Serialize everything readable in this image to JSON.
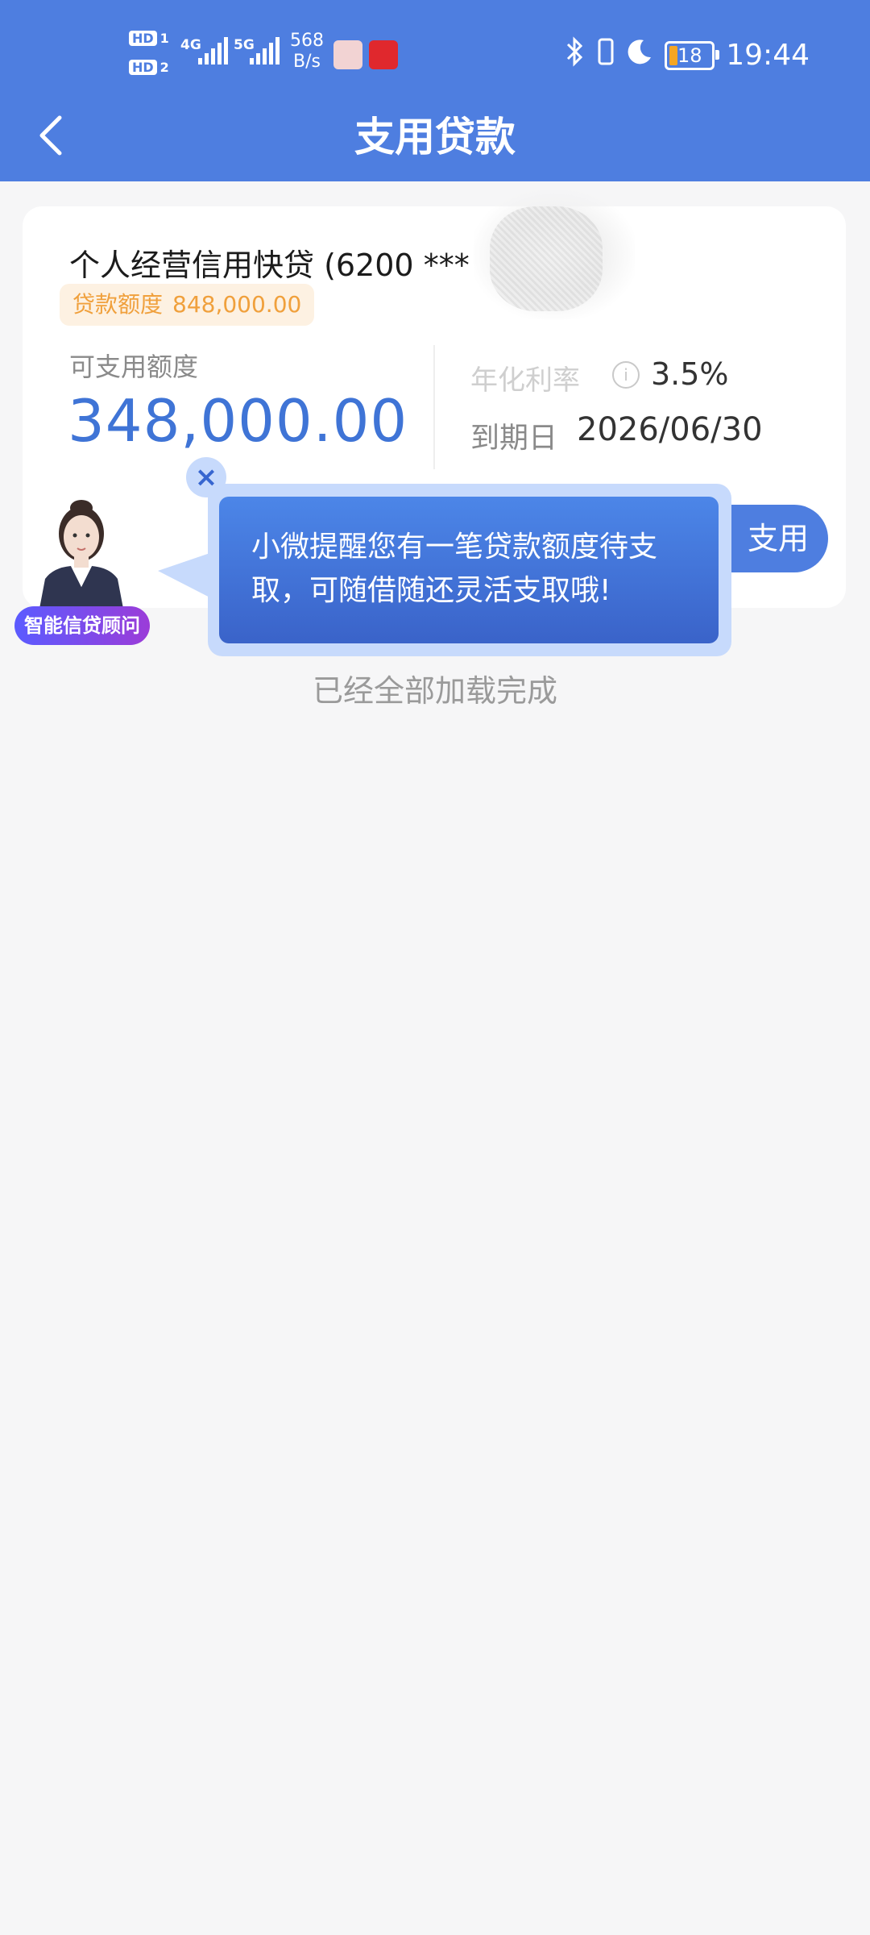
{
  "status_bar": {
    "hd1": "HD",
    "hd1_num": "1",
    "hd2": "HD",
    "hd2_num": "2",
    "network1": "4G",
    "network2": "5G",
    "speed_value": "568",
    "speed_unit": "B/s",
    "battery_level": "18",
    "time": "19:44"
  },
  "nav": {
    "title": "支用贷款"
  },
  "loan_card": {
    "product_name": "个人经营信用快贷 (6200 ***",
    "quota_label": "贷款额度",
    "quota_value": "848,000.00",
    "available_label": "可支用额度",
    "available_amount": "348,000.00",
    "rate_label": "年化利率",
    "rate_value": "3.5%",
    "due_label": "到期日",
    "due_value": "2026/06/30",
    "draw_button": "支用"
  },
  "advisor": {
    "badge_label": "智能信贷顾问",
    "message": "小微提醒您有一笔贷款额度待支取，可随借随还灵活支取哦!"
  },
  "footer": {
    "loaded_text": "已经全部加载完成"
  },
  "colors": {
    "brand_blue": "#4e7ee0",
    "amount_blue": "#3f74d6",
    "quota_orange": "#f0a03c",
    "page_bg": "#f6f6f7"
  }
}
